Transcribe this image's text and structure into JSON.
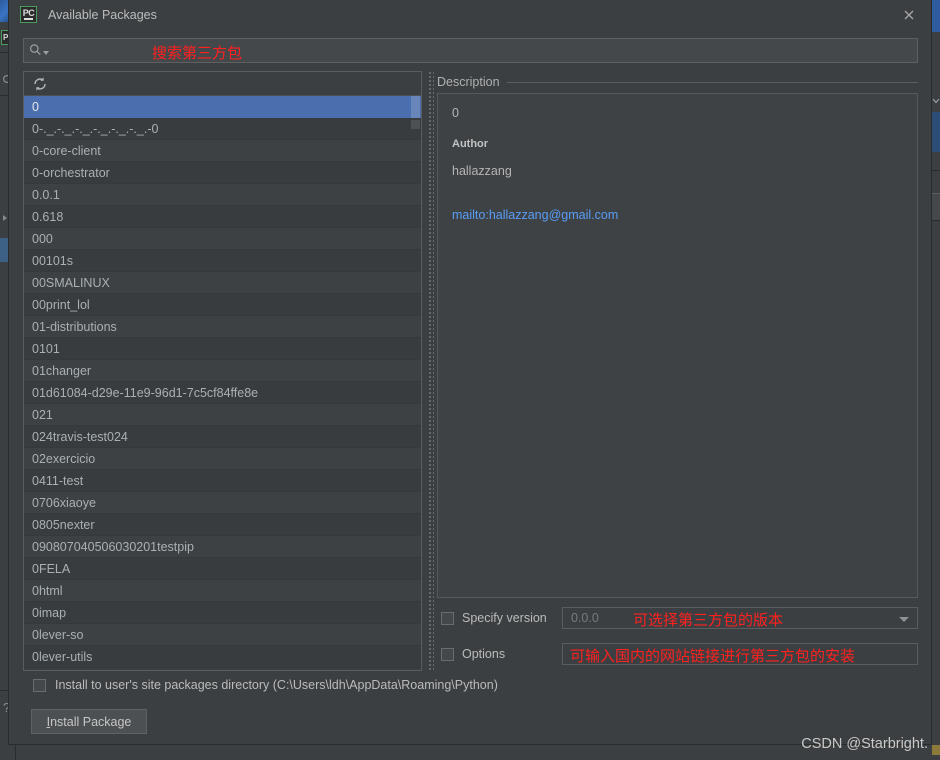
{
  "window": {
    "title": "Available Packages",
    "app_icon": "pycharm-pc-icon",
    "close_icon": "close-icon"
  },
  "search": {
    "icon": "search-icon",
    "value": "",
    "placeholder": "",
    "annotation": "搜索第三方包"
  },
  "list": {
    "refresh_icon": "refresh-icon",
    "selected_index": 0,
    "packages": [
      "0",
      "0-._.-._.-._.-._.-._.-._.-0",
      "0-core-client",
      "0-orchestrator",
      "0.0.1",
      "0.618",
      "000",
      "00101s",
      "00SMALINUX",
      "00print_lol",
      "01-distributions",
      "0101",
      "01changer",
      "01d61084-d29e-11e9-96d1-7c5cf84ffe8e",
      "021",
      "024travis-test024",
      "02exercicio",
      "0411-test",
      "0706xiaoye",
      "0805nexter",
      "090807040506030201testpip",
      "0FELA",
      "0html",
      "0imap",
      "0lever-so",
      "0lever-utils"
    ]
  },
  "description": {
    "header": "Description",
    "package_name": "0",
    "author_heading": "Author",
    "author_name": "hallazzang",
    "mail_link": "mailto:hallazzang@gmail.com"
  },
  "controls": {
    "specify_version_label": "Specify version",
    "specify_version_checked": false,
    "version_placeholder": "0.0.0",
    "version_annotation": "可选择第三方包的版本",
    "options_label": "Options",
    "options_checked": false,
    "options_value": "",
    "options_annotation": "可输入国内的网站链接进行第三方包的安装",
    "install_dir_label": "Install to user's site packages directory (C:\\Users\\ldh\\AppData\\Roaming\\Python)",
    "install_dir_checked": false,
    "install_button_label": "Install Package",
    "install_button_mnemonic": "I"
  },
  "watermark": "CSDN @Starbright.",
  "colors": {
    "dialog_bg": "#3c3f41",
    "row_odd": "#3e4143",
    "row_even": "#393c3e",
    "selection": "#4b6eaf",
    "link": "#589df6",
    "annotation_red": "#ff2020",
    "text": "#bbbbbb"
  }
}
